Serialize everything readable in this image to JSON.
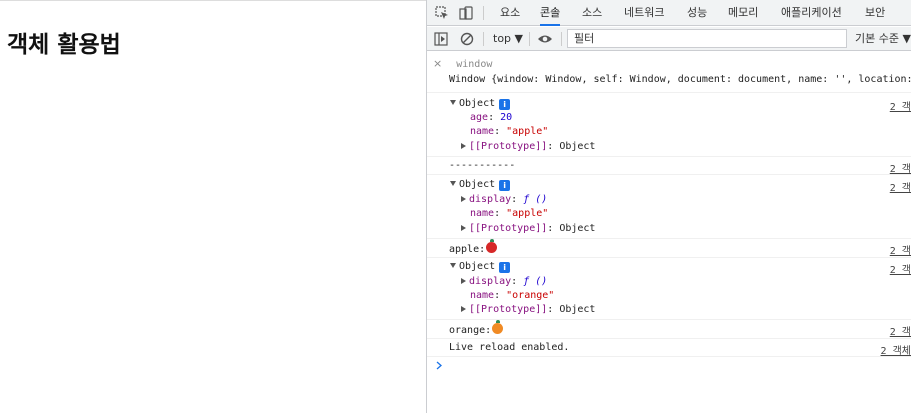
{
  "page": {
    "heading": "객체 활용법"
  },
  "devtools": {
    "tabs": [
      "요소",
      "콘솔",
      "소스",
      "네트워크",
      "성능",
      "메모리",
      "애플리케이션",
      "보안"
    ],
    "active_tab": "콘솔",
    "context": "top ▼",
    "filter_value": "필터",
    "levels": "기본 수준 ▼",
    "eval_input": "window",
    "eval_result": "Window {window: Window, self: Window, document: document, name: '', location: ",
    "source_link": "2 객",
    "source_link_last": "2 객체",
    "logs": {
      "obj1": {
        "label": "Object",
        "age_key": "age",
        "age_val": "20",
        "name_key": "name",
        "name_val": "\"apple\"",
        "proto_key": "[[Prototype]]",
        "proto_val": "Object"
      },
      "sep": "-----------",
      "obj2": {
        "label": "Object",
        "display_key": "display",
        "display_val": "ƒ ()",
        "name_key": "name",
        "name_val": "\"apple\"",
        "proto_key": "[[Prototype]]",
        "proto_val": "Object"
      },
      "apple": "apple:",
      "obj3": {
        "label": "Object",
        "display_key": "display",
        "display_val": "ƒ ()",
        "name_key": "name",
        "name_val": "\"orange\"",
        "proto_key": "[[Prototype]]",
        "proto_val": "Object"
      },
      "orange": "orange:",
      "reload": "Live reload enabled."
    },
    "colors": {
      "accent": "#1a73e8",
      "apple": "#d62828",
      "orange": "#f08a24"
    }
  }
}
